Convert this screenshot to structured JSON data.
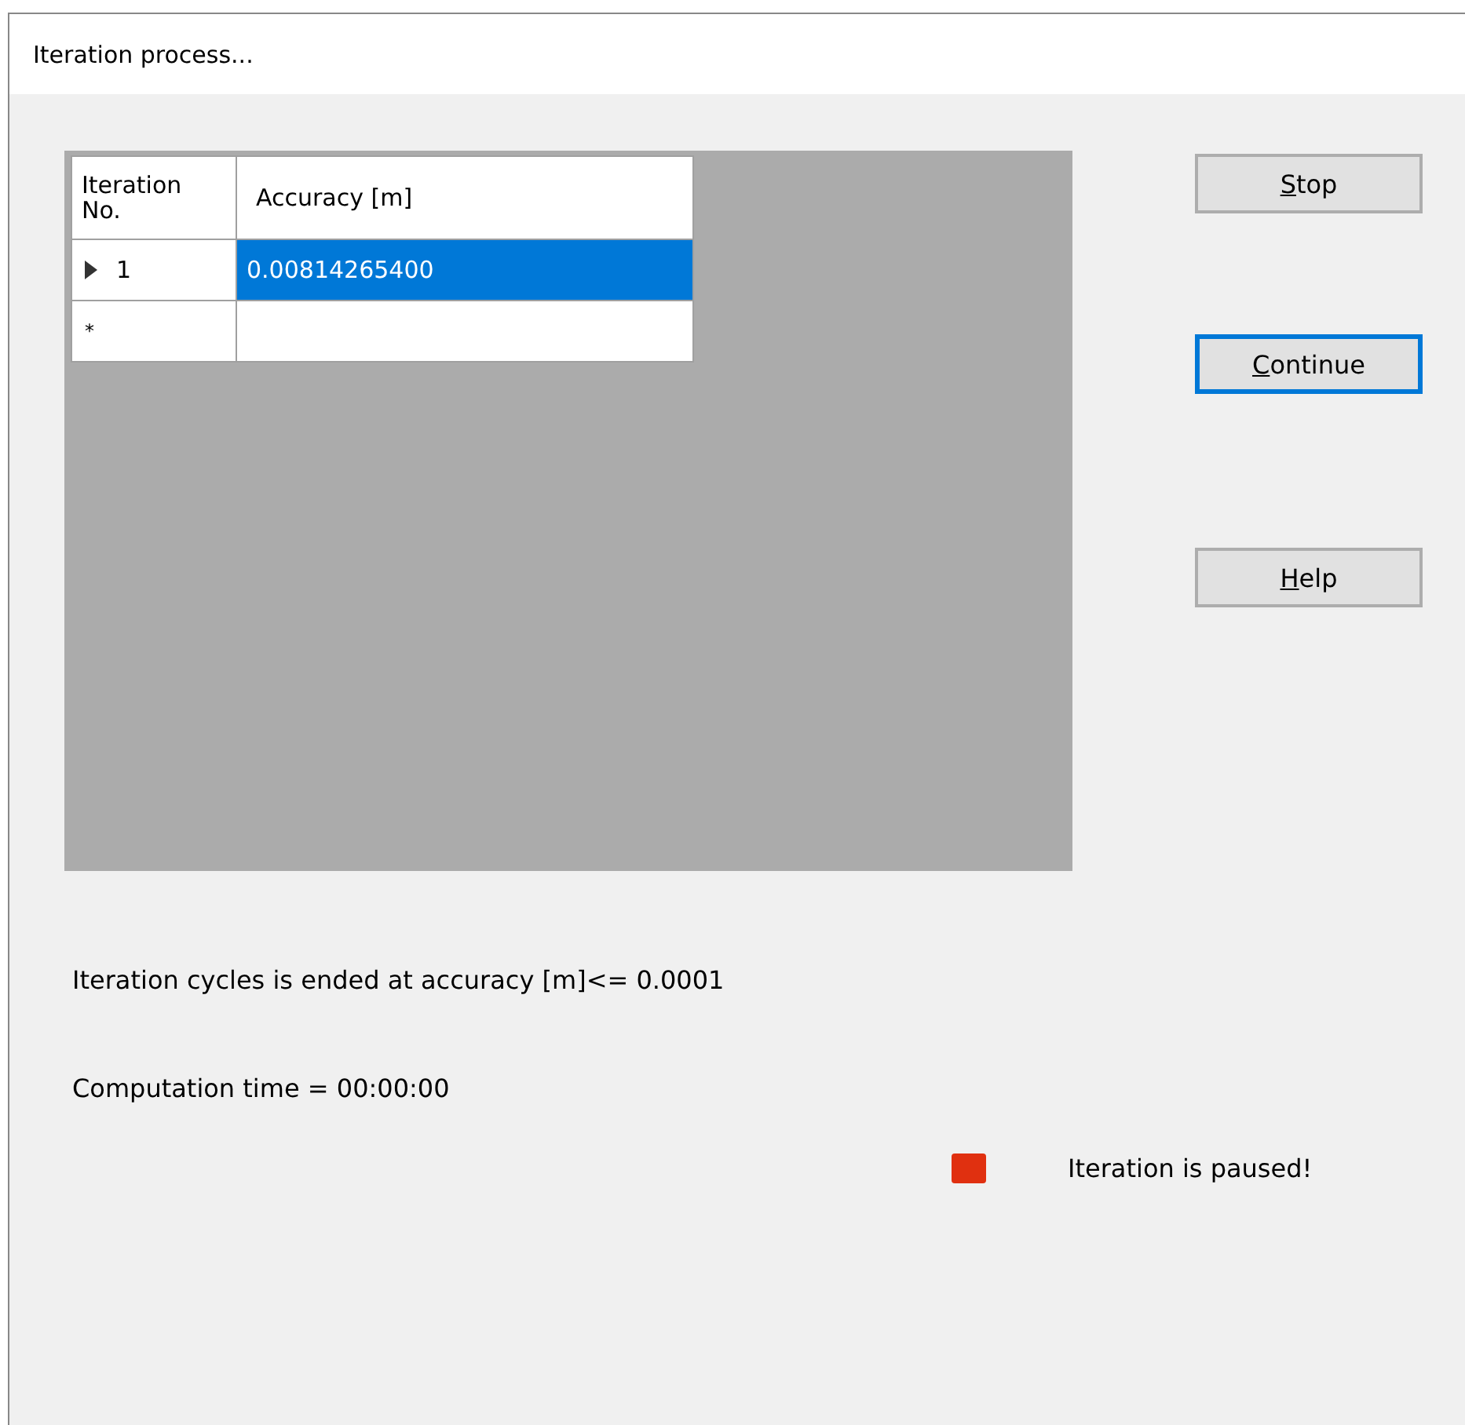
{
  "window": {
    "title": "Iteration process..."
  },
  "table": {
    "columns": [
      "Iteration No.",
      "Accuracy [m]"
    ],
    "rows": [
      {
        "kind": "data",
        "number": "1",
        "accuracy": "0.00814265400",
        "selected": true,
        "current": true
      },
      {
        "kind": "new",
        "marker": "*",
        "selected": false
      }
    ]
  },
  "buttons": [
    {
      "access_key": "S",
      "label_rest": "top",
      "focused": false
    },
    {
      "access_key": "C",
      "label_rest": "ontinue",
      "focused": true
    },
    {
      "access_key": "H",
      "label_rest": "elp",
      "focused": false
    }
  ],
  "info": {
    "accuracy_limit": "Iteration cycles is ended at accuracy [m]<= 0.0001",
    "computation_time": "Computation time = 00:00:00"
  },
  "status": {
    "paused": true,
    "text": "Iteration is paused!",
    "color": "#e03010"
  }
}
